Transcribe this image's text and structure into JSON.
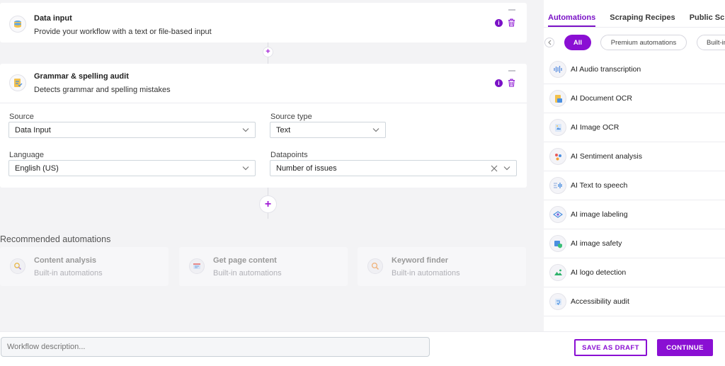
{
  "workflow": {
    "steps": [
      {
        "title": "Data input",
        "subtitle": "Provide your workflow with a text or file-based input"
      },
      {
        "title": "Grammar & spelling audit",
        "subtitle": "Detects grammar and spelling mistakes"
      }
    ],
    "fields": {
      "source": {
        "label": "Source",
        "value": "Data Input"
      },
      "source_type": {
        "label": "Source type",
        "value": "Text"
      },
      "language": {
        "label": "Language",
        "value": "English (US)"
      },
      "datapoints": {
        "label": "Datapoints",
        "value": "Number of issues"
      }
    },
    "add_step_symbol": "+"
  },
  "recommended": {
    "heading": "Recommended automations",
    "items": [
      {
        "title": "Content analysis",
        "subtitle": "Built-in automations",
        "icon": "magnifier-spark-icon"
      },
      {
        "title": "Get page content",
        "subtitle": "Built-in automations",
        "icon": "page-content-icon"
      },
      {
        "title": "Keyword finder",
        "subtitle": "Built-in automations",
        "icon": "keyword-search-icon"
      }
    ]
  },
  "panel": {
    "tabs": [
      "Automations",
      "Scraping Recipes",
      "Public Scraping"
    ],
    "active_tab": "Automations",
    "chips": [
      "All",
      "Premium automations",
      "Built-in"
    ],
    "automations": [
      {
        "label": "AI Audio transcription",
        "icon": "audio-wave-icon"
      },
      {
        "label": "AI Document OCR",
        "icon": "document-ocr-icon"
      },
      {
        "label": "AI Image OCR",
        "icon": "image-ocr-icon"
      },
      {
        "label": "AI Sentiment analysis",
        "icon": "sentiment-icon"
      },
      {
        "label": "AI Text to speech",
        "icon": "text-to-speech-icon"
      },
      {
        "label": "AI image labeling",
        "icon": "image-label-icon"
      },
      {
        "label": "AI image safety",
        "icon": "image-safety-icon"
      },
      {
        "label": "AI logo detection",
        "icon": "logo-detection-icon"
      },
      {
        "label": "Accessibility audit",
        "icon": "accessibility-icon"
      }
    ]
  },
  "footer": {
    "description_placeholder": "Workflow description...",
    "save_draft_label": "SAVE AS DRAFT",
    "continue_label": "CONTINUE"
  },
  "colors": {
    "accent": "#8a0fd3",
    "info": "#7a12c6"
  }
}
